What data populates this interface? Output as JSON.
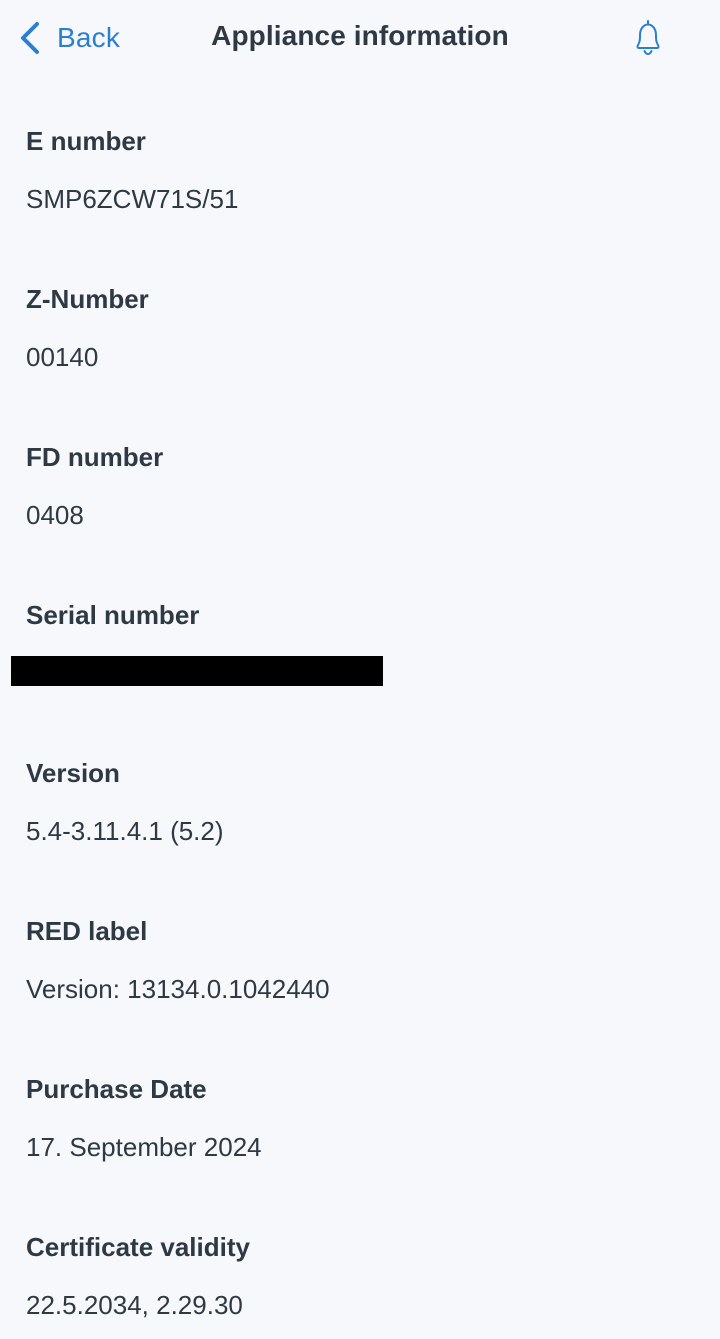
{
  "header": {
    "back_label": "Back",
    "title": "Appliance information",
    "back_icon": "chevron-left-icon",
    "bell_icon": "bell-icon"
  },
  "colors": {
    "background": "#f6f8fc",
    "accent": "#2a7fd1",
    "text": "#2f3944"
  },
  "items": [
    {
      "label": "E number",
      "value": "SMP6ZCW71S/51"
    },
    {
      "label": "Z-Number",
      "value": "00140"
    },
    {
      "label": "FD number",
      "value": "0408"
    },
    {
      "label": "Serial number",
      "value": ""
    },
    {
      "label": "Version",
      "value": "5.4-3.11.4.1 (5.2)"
    },
    {
      "label": "RED label",
      "value": "Version: 13134.0.1042440"
    },
    {
      "label": "Purchase Date",
      "value": "17. September 2024"
    },
    {
      "label": "Certificate validity",
      "value": "22.5.2034, 2.29.30"
    }
  ]
}
